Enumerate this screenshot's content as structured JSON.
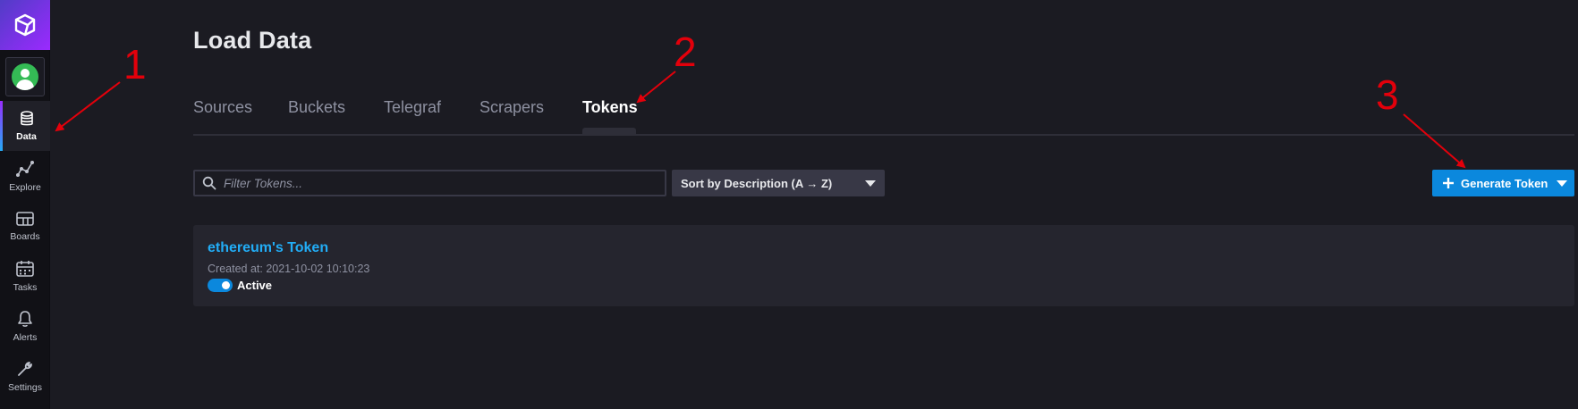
{
  "sidebar": {
    "items": [
      {
        "label": "Data",
        "icon": "database-icon",
        "active": true
      },
      {
        "label": "Explore",
        "icon": "graph-line-icon"
      },
      {
        "label": "Boards",
        "icon": "dashboard-grid-icon"
      },
      {
        "label": "Tasks",
        "icon": "calendar-icon"
      },
      {
        "label": "Alerts",
        "icon": "bell-icon"
      },
      {
        "label": "Settings",
        "icon": "wrench-icon"
      }
    ]
  },
  "page": {
    "title": "Load Data"
  },
  "tabs": [
    {
      "label": "Sources"
    },
    {
      "label": "Buckets"
    },
    {
      "label": "Telegraf"
    },
    {
      "label": "Scrapers"
    },
    {
      "label": "Tokens",
      "active": true
    }
  ],
  "filter": {
    "placeholder": "Filter Tokens...",
    "value": ""
  },
  "sort": {
    "label": "Sort by Description (A → Z)"
  },
  "generate": {
    "label": "Generate Token"
  },
  "tokens": [
    {
      "name": "ethereum's Token",
      "created": "Created at: 2021-10-02 10:10:23",
      "status": "Active",
      "enabled": true
    }
  ],
  "annotations": [
    {
      "label": "1"
    },
    {
      "label": "2"
    },
    {
      "label": "3"
    }
  ],
  "colors": {
    "background": "#1b1b22",
    "sidebar": "#111116",
    "accent_blue": "#0b88dd",
    "link_blue": "#22adf6",
    "annotation_red": "#e3000b"
  }
}
